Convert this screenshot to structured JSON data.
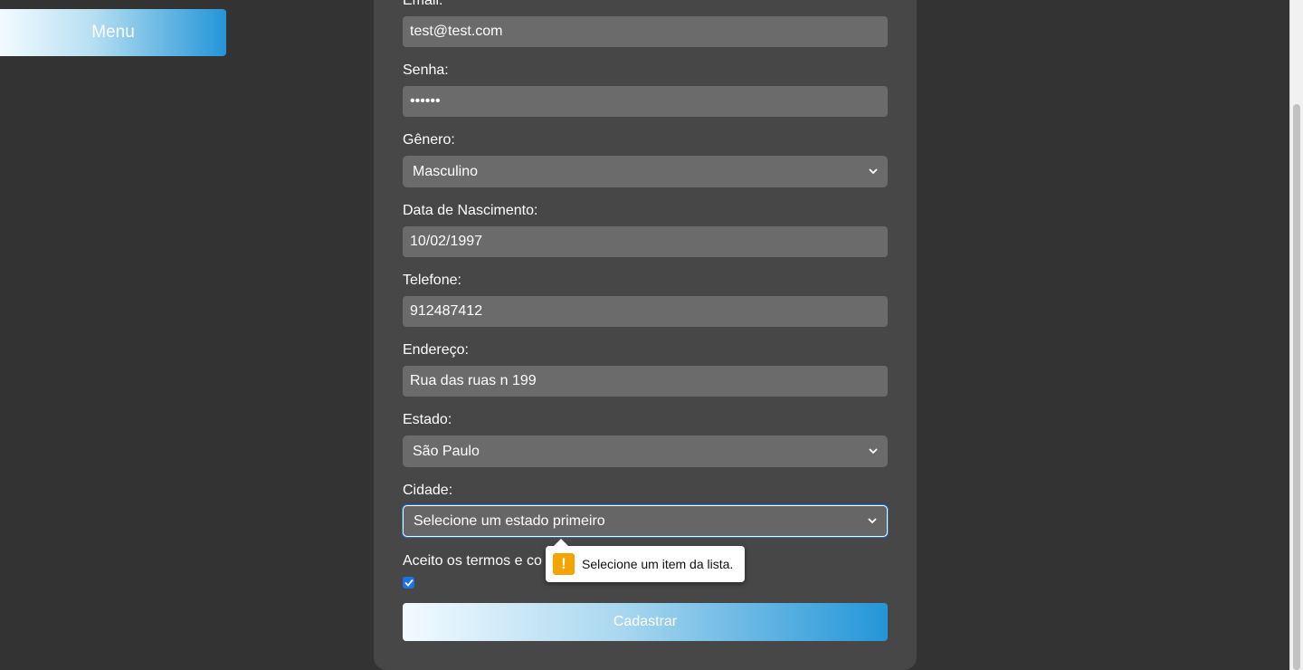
{
  "menu": {
    "label": "Menu"
  },
  "form": {
    "email": {
      "label": "Email:",
      "value": "test@test.com"
    },
    "password": {
      "label": "Senha:",
      "value": "••••••"
    },
    "gender": {
      "label": "Gênero:",
      "selected": "Masculino"
    },
    "birthdate": {
      "label": "Data de Nascimento:",
      "value": "10/02/1997"
    },
    "phone": {
      "label": "Telefone:",
      "value": "912487412"
    },
    "address": {
      "label": "Endereço:",
      "value": "Rua das ruas n 199"
    },
    "state": {
      "label": "Estado:",
      "selected": "São Paulo"
    },
    "city": {
      "label": "Cidade:",
      "selected": "Selecione um estado primeiro"
    },
    "terms": {
      "label": "Aceito os termos e co",
      "checked": true
    },
    "submit_label": "Cadastrar"
  },
  "validation_tooltip": {
    "message": "Selecione um item da lista.",
    "icon": "warning-icon"
  },
  "colors": {
    "background": "#333333",
    "card": "#474747",
    "field": "#6b6b6b",
    "accent": "#2495d8",
    "focus": "#1a73e8",
    "warning": "#f5a300"
  }
}
